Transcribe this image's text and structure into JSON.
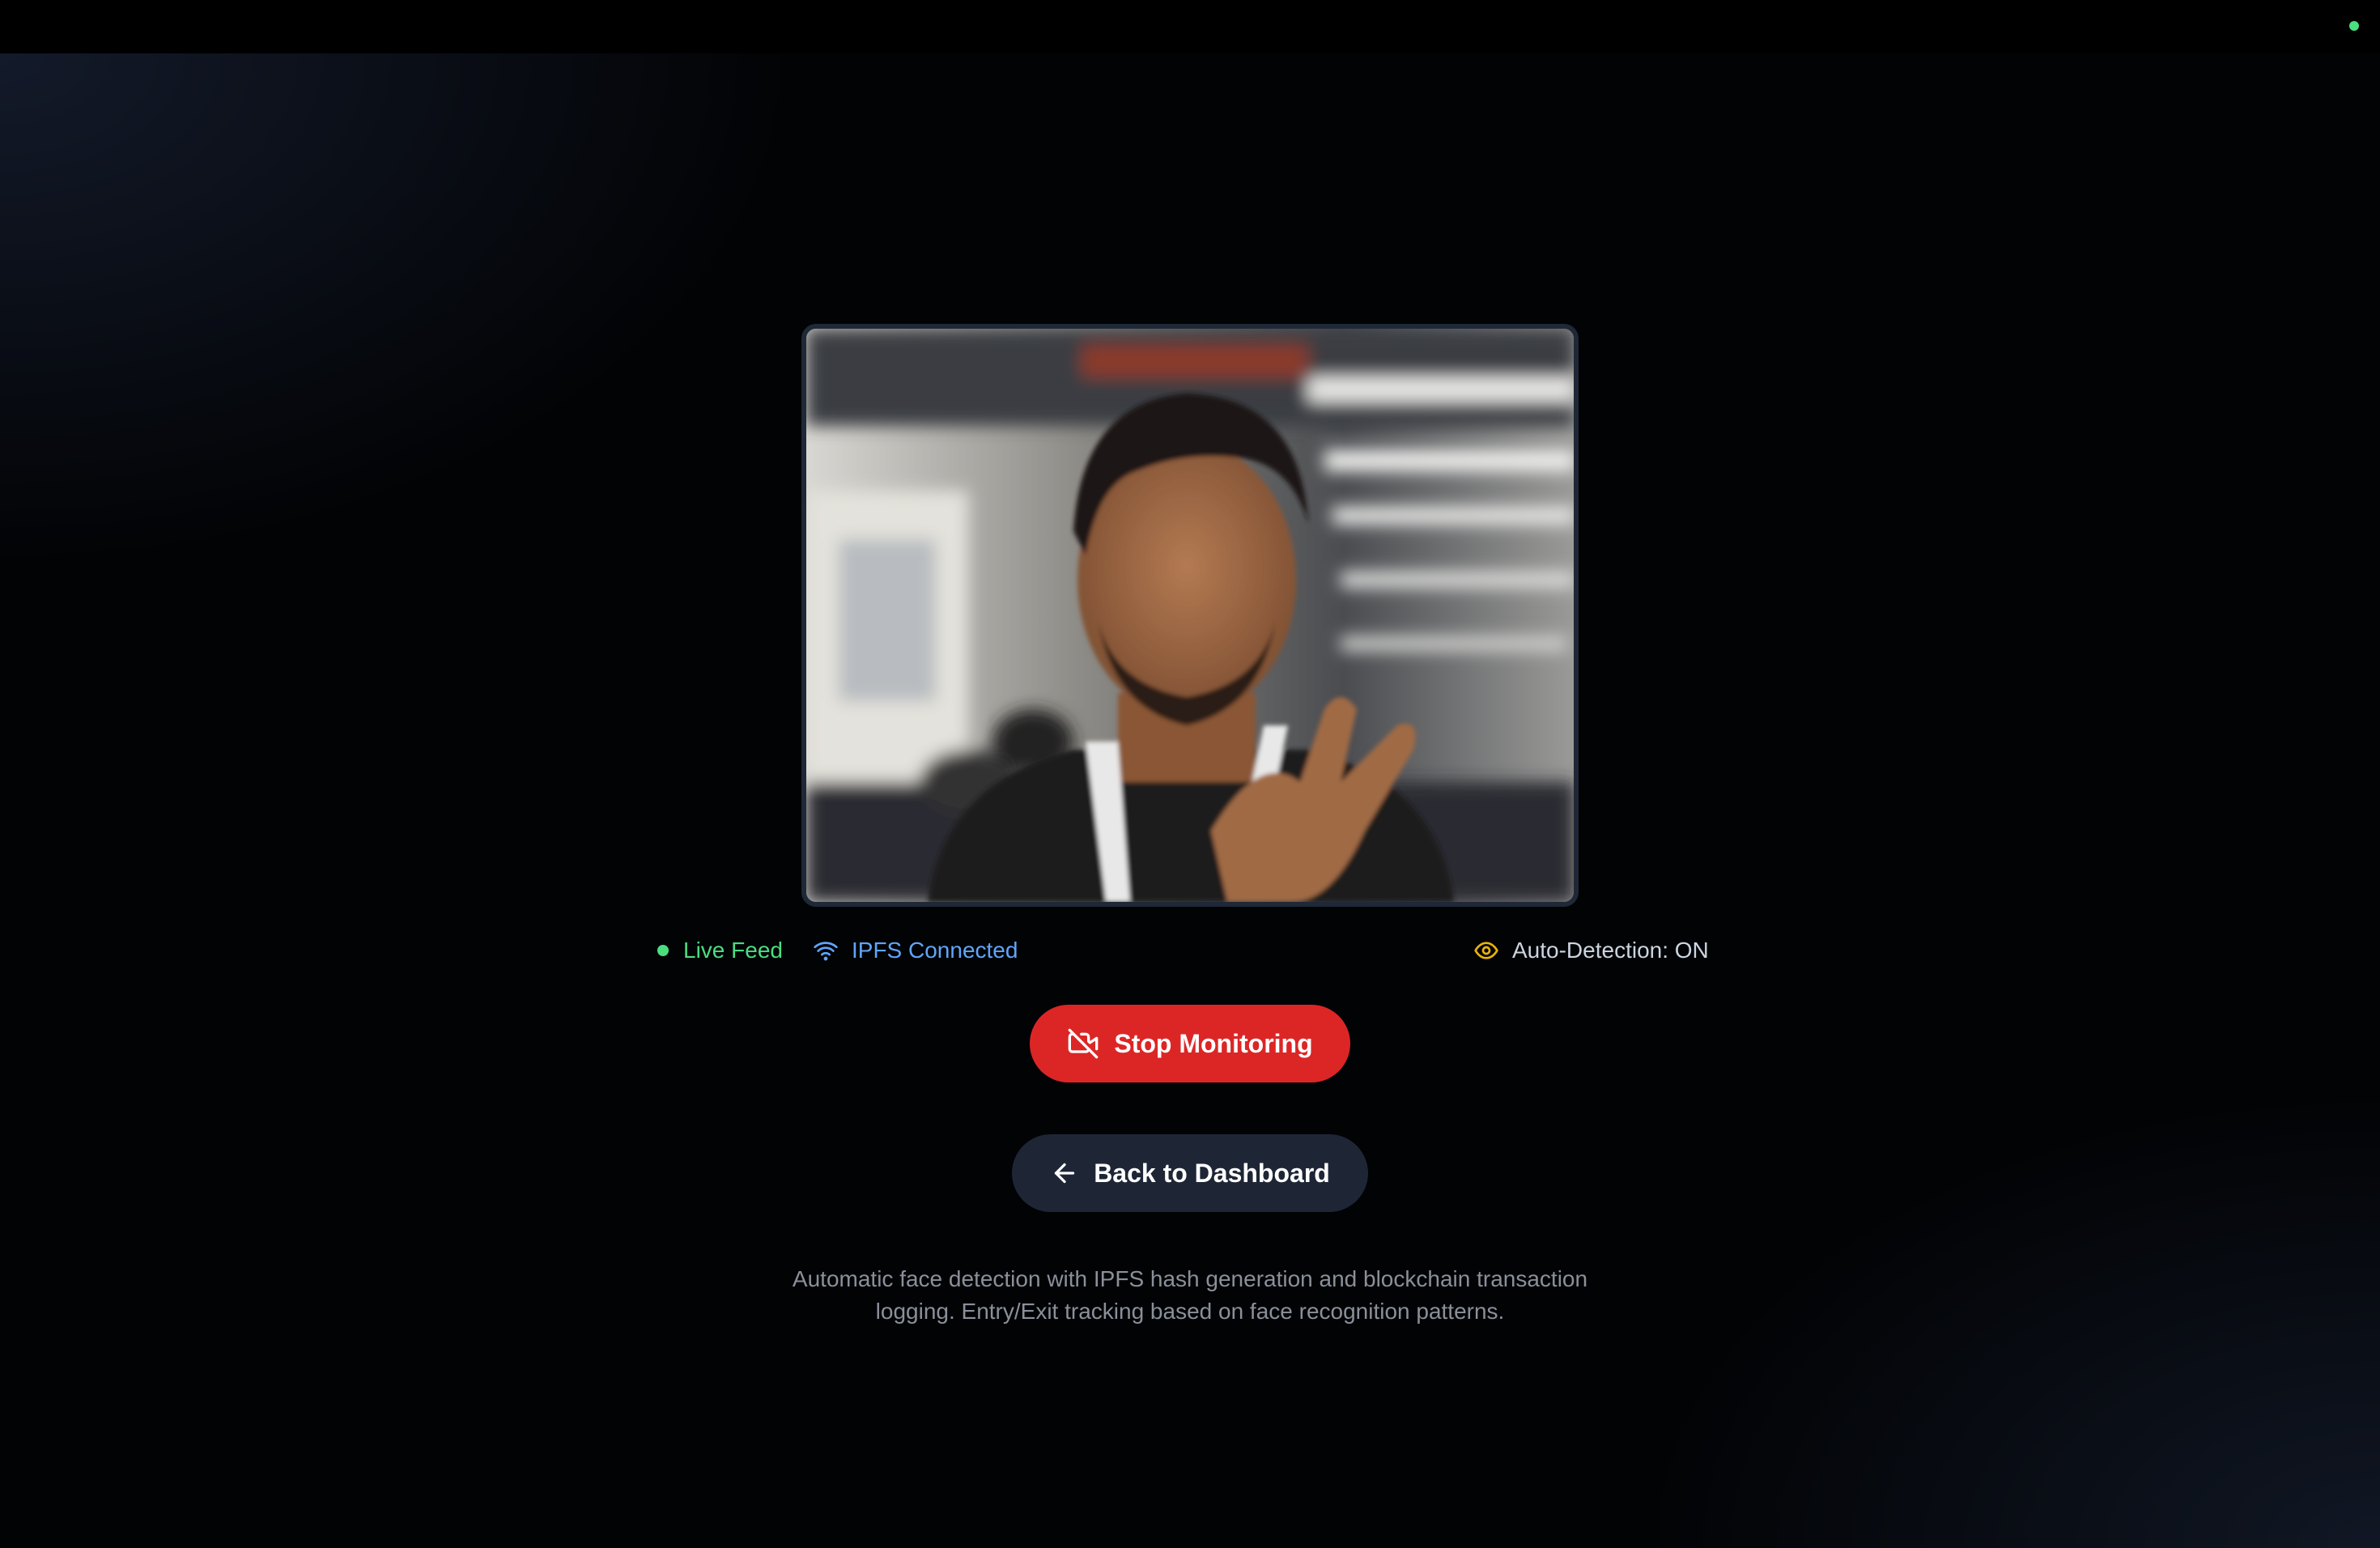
{
  "colors": {
    "live_green": "#4ade80",
    "ipfs_blue": "#60a5fa",
    "detection_yellow": "#eab308",
    "stop_red": "#dc2626",
    "back_button_bg": "#1e2636",
    "caption_gray": "#8a909a",
    "status_text_gray": "#cbd5e1"
  },
  "indicators": {
    "top_right": "status-dot",
    "live_feed": "Live Feed",
    "ipfs": "IPFS Connected",
    "auto_detection": "Auto-Detection: ON"
  },
  "icons": {
    "ipfs": "wifi-icon",
    "auto_detection": "eye-icon",
    "stop": "video-off-icon",
    "back": "arrow-left-icon"
  },
  "buttons": {
    "stop_label": "Stop Monitoring",
    "back_label": "Back to Dashboard"
  },
  "caption": {
    "line1": "Automatic face detection with IPFS hash generation and blockchain transaction",
    "line2": "logging. Entry/Exit tracking based on face recognition patterns."
  }
}
